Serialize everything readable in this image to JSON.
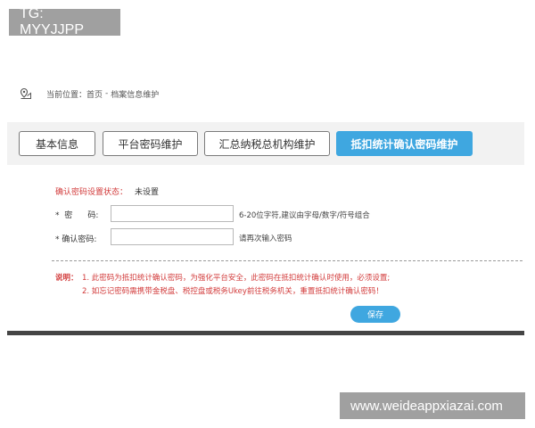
{
  "watermarks": {
    "top_left": "TG: MYYJJPP",
    "bottom_right": "www.weideappxiazai.com"
  },
  "breadcrumb": {
    "icon": "location-pin-icon",
    "prefix": "当前位置：",
    "home": "首页",
    "separator": "-",
    "current": "档案信息维护"
  },
  "tabs": [
    {
      "label": "基本信息",
      "active": false
    },
    {
      "label": "平台密码维护",
      "active": false
    },
    {
      "label": "汇总纳税总机构维护",
      "active": false
    },
    {
      "label": "抵扣统计确认密码维护",
      "active": true
    }
  ],
  "form": {
    "status_label": "确认密码设置状态：",
    "status_value": "未设置",
    "password_label": "*  密      码:",
    "password_value": "",
    "password_hint": "6-20位字符,建议由字母/数字/符号组合",
    "confirm_label": "* 确认密码:",
    "confirm_value": "",
    "confirm_hint": "请再次输入密码"
  },
  "note": {
    "title": "说明：",
    "lines": [
      "1. 此密码为抵扣统计确认密码，为强化平台安全，此密码在抵扣统计确认时使用，必须设置;",
      "2. 如忘记密码需携带金税盘、税控盘或税务Ukey前往税务机关，重置抵扣统计确认密码！"
    ]
  },
  "actions": {
    "save_label": "保存"
  },
  "colors": {
    "accent": "#3fa7e0",
    "warning_text": "#d23a3a"
  }
}
